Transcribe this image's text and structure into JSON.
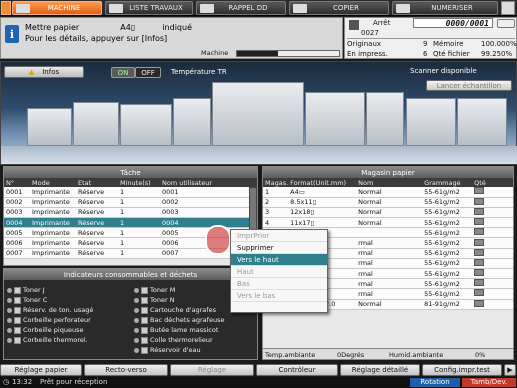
{
  "tabs": [
    {
      "label": "MACHINE",
      "active": true
    },
    {
      "label": "LISTE TRAVAUX",
      "active": false
    },
    {
      "label": "RAPPEL DD",
      "active": false
    },
    {
      "label": "COPIER",
      "active": false
    },
    {
      "label": "NUMERISER",
      "active": false
    }
  ],
  "info": {
    "line1a": "Mettre papier",
    "line1b": "A4▯",
    "line1c": "indiqué",
    "line2": "Pour les détails, appuyer sur [Infos]",
    "machine_label": "Machine",
    "machine_progress": 0.4
  },
  "counter": {
    "arret_label": "Arrêt",
    "arret_value": "0000/0001",
    "job_count": "0027",
    "rows": [
      {
        "l": "Originaux",
        "v": "9",
        "l2": "Mémoire",
        "v2": "100.000%"
      },
      {
        "l": "En impress.",
        "v": "6",
        "l2": "Qté fichier",
        "v2": "99.250%"
      }
    ]
  },
  "machine": {
    "infos_label": "Infos",
    "on_label": "ON",
    "off_label": "OFF",
    "temp_label": "Température TR",
    "scanner_label": "Scanner disponible",
    "lancer_label": "Lancer échantillon"
  },
  "tache": {
    "title": "Tâche",
    "headers": [
      "N°",
      "Mode",
      "Etat",
      "Minute(s)",
      "Nom utilisateur"
    ],
    "rows": [
      [
        "0001",
        "Imprimante",
        "Réserve",
        "1",
        "0001"
      ],
      [
        "0002",
        "Imprimante",
        "Réserve",
        "1",
        "0002"
      ],
      [
        "0003",
        "Imprimante",
        "Réserve",
        "1",
        "0003"
      ],
      [
        "0004",
        "Imprimante",
        "Réserve",
        "1",
        "0004"
      ],
      [
        "0005",
        "Imprimante",
        "Réserve",
        "1",
        "0005"
      ],
      [
        "0006",
        "Imprimante",
        "Réserve",
        "1",
        "0006"
      ],
      [
        "0007",
        "Imprimante",
        "Réserve",
        "1",
        "0007"
      ]
    ],
    "selected_index": 3
  },
  "magasin": {
    "title": "Magasin papier",
    "headers": [
      "Magas.",
      "Format(Unit.mm)",
      "Nom",
      "Grammage",
      "Qté"
    ],
    "rows": [
      [
        "1",
        "A4▭",
        "Normal",
        "55-61g/m2"
      ],
      [
        "2",
        "8.5x11▯",
        "Normal",
        "55-61g/m2"
      ],
      [
        "3",
        "12x18▯",
        "Normal",
        "55-61g/m2"
      ],
      [
        "4",
        "11x17▯",
        "Normal",
        "55-61g/m2"
      ],
      [
        "",
        "",
        "",
        "55-61g/m2"
      ],
      [
        "",
        "",
        "rmal",
        "55-61g/m2"
      ],
      [
        "",
        "",
        "rmal",
        "55-61g/m2"
      ],
      [
        "",
        "",
        "rmal",
        "55-61g/m2"
      ],
      [
        "",
        "",
        "rmal",
        "55-61g/m2"
      ],
      [
        "",
        "",
        "rmal",
        "55-61g/m2"
      ],
      [
        "",
        "",
        "rmal",
        "55-61g/m2"
      ],
      [
        "PB",
        "307.0 x 472.0",
        "Normal",
        "81-91g/m2"
      ]
    ],
    "temp_label": "Temp.ambiante",
    "temp_value": "0Degrés",
    "hum_label": "Humid.ambiante",
    "hum_value": "0%"
  },
  "consommables": {
    "title": "Indicateurs consommables et déchets",
    "left": [
      "Toner J",
      "Toner C",
      "Réserv. de ton. usagé",
      "Corbeille perforateur",
      "Corbeille piqueuse",
      "Corbeille thermorel."
    ],
    "right": [
      "Toner M",
      "Toner N",
      "Cartouche d'agrafes",
      "Bac déchets agrafeuse",
      "Butée lame massicot",
      "Colle thermorelieur",
      "Réservoir d'eau"
    ]
  },
  "context_menu": {
    "items": [
      {
        "label": "ImprPrior",
        "enabled": false,
        "highlight": false
      },
      {
        "label": "Supprimer",
        "enabled": true,
        "highlight": false
      },
      {
        "label": "Vers le haut",
        "enabled": true,
        "highlight": true
      },
      {
        "label": "Haut",
        "enabled": false,
        "highlight": false
      },
      {
        "label": "Bas",
        "enabled": false,
        "highlight": false
      },
      {
        "label": "Vers le bas",
        "enabled": false,
        "highlight": false
      }
    ]
  },
  "bottom": {
    "buttons": [
      "Réglage papier",
      "Recto-verso",
      "Réglage",
      "Contrôleur",
      "Réglage détaillé",
      "Config.impr.test"
    ],
    "time": "13:32",
    "status": "Prêt pour réception",
    "rotation": "Rotation",
    "tamb": "Tamb/Dev."
  }
}
